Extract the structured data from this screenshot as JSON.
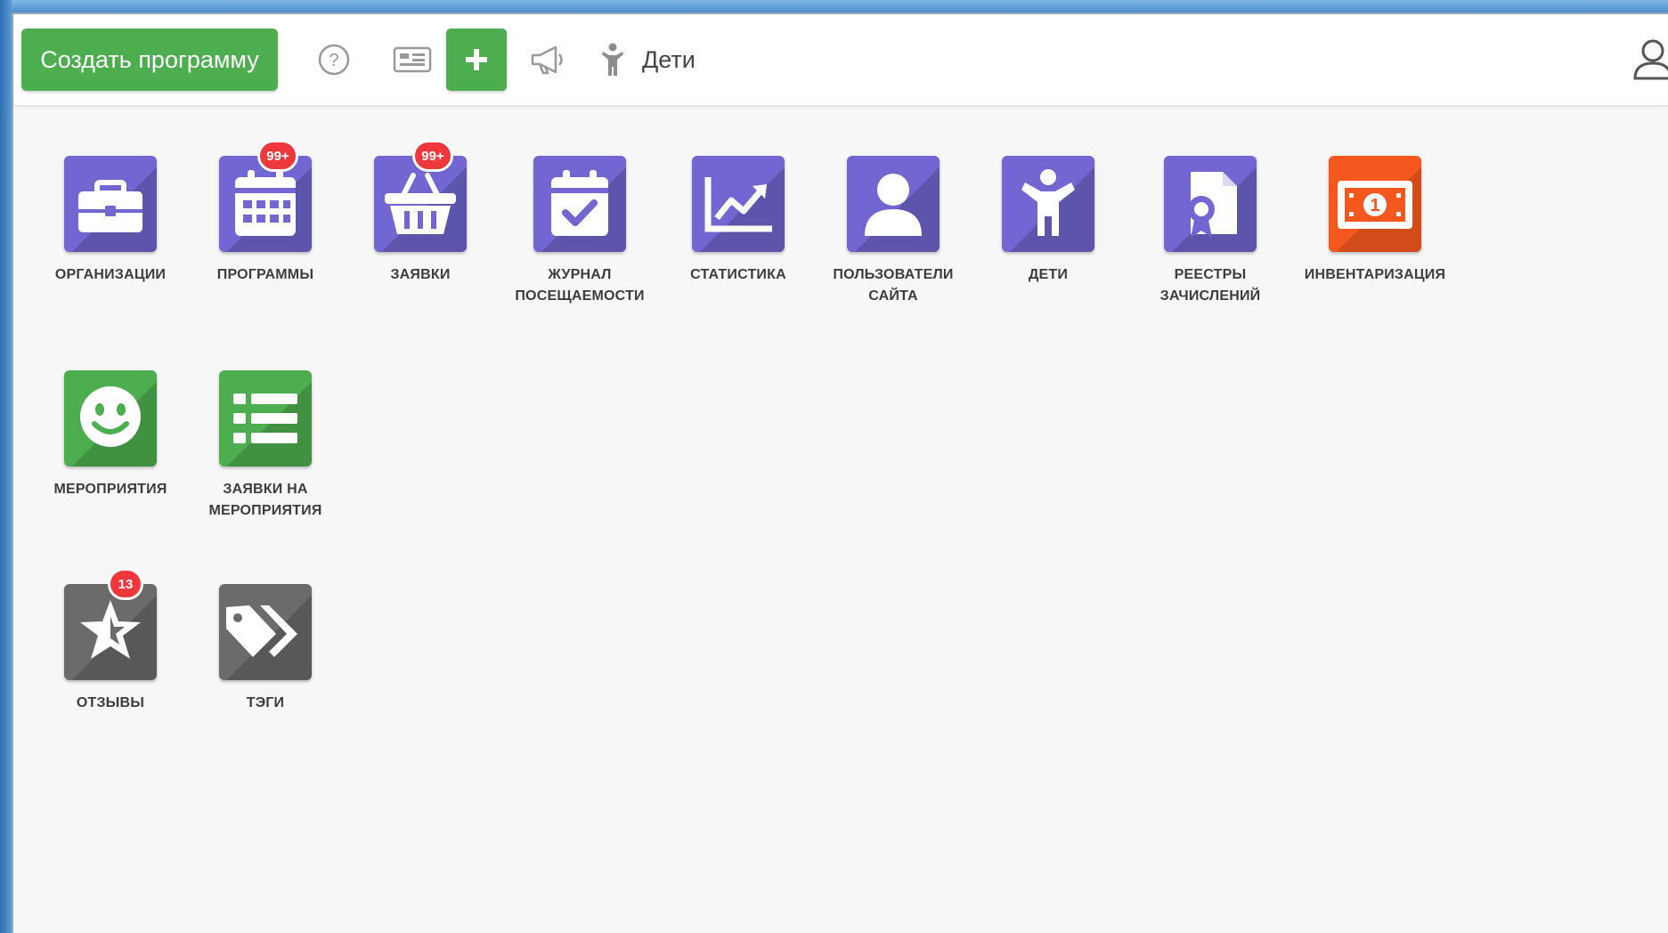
{
  "toolbar": {
    "create_label": "Создать программу",
    "children_label": "Дети"
  },
  "colors": {
    "green": "#4cae4f",
    "purple": "#7166d2",
    "orange": "#f4581f",
    "gray": "#6d6a6a",
    "badge": "#f0373b"
  },
  "tiles": [
    {
      "label": "ОРГАНИЗАЦИИ",
      "icon": "briefcase-icon",
      "color": "purple",
      "badge": ""
    },
    {
      "label": "ПРОГРАММЫ",
      "icon": "calendar-icon",
      "color": "purple",
      "badge": "99+"
    },
    {
      "label": "ЗАЯВКИ",
      "icon": "basket-icon",
      "color": "purple",
      "badge": "99+"
    },
    {
      "label": "ЖУРНАЛ ПОСЕЩАЕМОСТИ",
      "icon": "calendar-check-icon",
      "color": "purple",
      "badge": ""
    },
    {
      "label": "СТАТИСТИКА",
      "icon": "chart-icon",
      "color": "purple",
      "badge": ""
    },
    {
      "label": "ПОЛЬЗОВАТЕЛИ САЙТА",
      "icon": "user-icon",
      "color": "purple",
      "badge": ""
    },
    {
      "label": "ДЕТИ",
      "icon": "child-icon",
      "color": "purple",
      "badge": ""
    },
    {
      "label": "РЕЕСТРЫ ЗАЧИСЛЕНИЙ",
      "icon": "certificate-icon",
      "color": "purple",
      "badge": ""
    },
    {
      "label": "ИНВЕНТАРИЗАЦИЯ",
      "icon": "banknote-icon",
      "color": "orange",
      "badge": ""
    },
    {
      "label": "МЕРОПРИЯТИЯ",
      "icon": "smile-icon",
      "color": "green",
      "badge": ""
    },
    {
      "label": "ЗАЯВКИ НА МЕРОПРИЯТИЯ",
      "icon": "list-icon",
      "color": "green",
      "badge": ""
    },
    {
      "label": "ОТЗЫВЫ",
      "icon": "star-icon",
      "color": "gray",
      "badge": "13"
    },
    {
      "label": "ТЭГИ",
      "icon": "tags-icon",
      "color": "gray",
      "badge": ""
    }
  ]
}
